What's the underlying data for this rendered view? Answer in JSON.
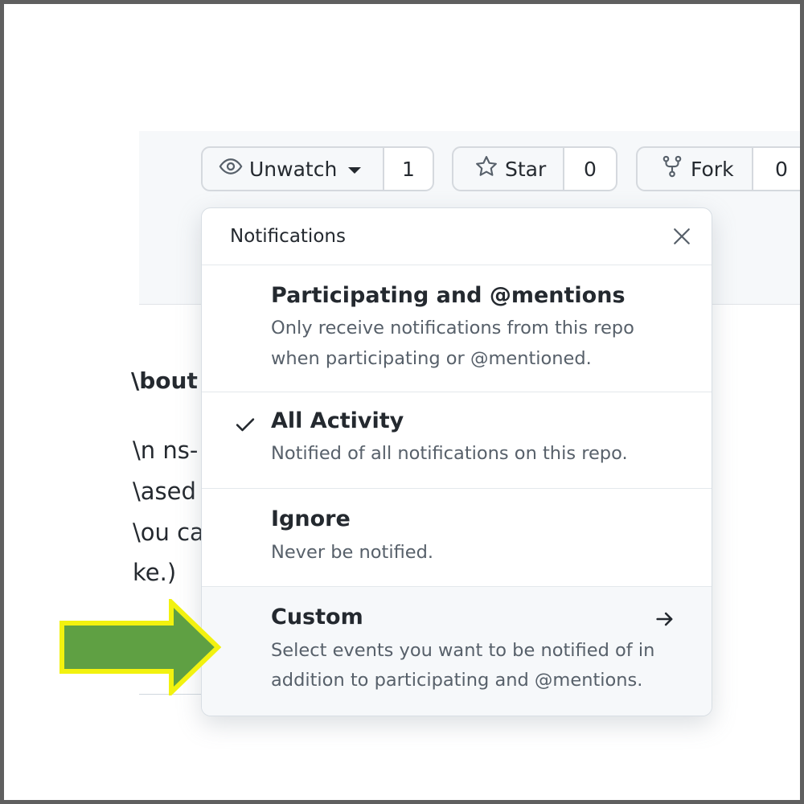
{
  "repo_actions": {
    "watch": {
      "label": "Unwatch",
      "count": "1",
      "icon": "eye-icon"
    },
    "star": {
      "label": "Star",
      "count": "0",
      "icon": "star-icon"
    },
    "fork": {
      "label": "Fork",
      "count": "0",
      "icon": "fork-icon"
    }
  },
  "about": {
    "title_fragment": "\\bout",
    "lines": [
      "\\n ns-",
      "\\ased",
      "\\ou ca",
      "ke.)"
    ]
  },
  "notifications": {
    "title": "Notifications",
    "close_icon": "close-icon",
    "options": [
      {
        "title": "Participating and @mentions",
        "desc_line1": "Only receive notifications from this repo",
        "desc_line2": "when participating or @mentioned.",
        "selected": false
      },
      {
        "title": "All Activity",
        "desc_line1": "Notified of all notifications on this repo.",
        "selected": true
      },
      {
        "title": "Ignore",
        "desc_line1": "Never be notified.",
        "selected": false
      },
      {
        "title": "Custom",
        "desc_line1": "Select events you want to be notified of in",
        "desc_line2": "addition to participating and @mentions.",
        "selected": false,
        "icon": "arrow-right-icon"
      }
    ]
  },
  "annotation": {
    "icon": "pointer-arrow-icon",
    "fill": "#5fa043",
    "outline": "#f2f20f"
  }
}
